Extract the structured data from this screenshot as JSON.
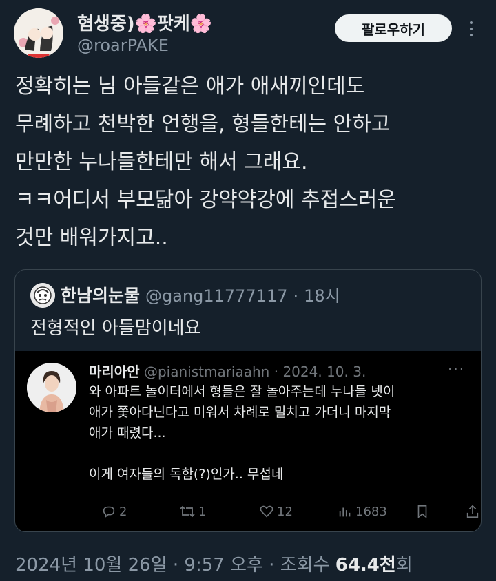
{
  "author": {
    "display_name": "혐생중)🌸팟케🌸",
    "handle": "@roarPAKE",
    "follow_label": "팔로우하기"
  },
  "tweet": {
    "text": "정확히는 님 아들같은 애가 애새끼인데도\n무례하고 천박한 언행을, 형들한테는 안하고\n만만한 누나들한테만 해서 그래요.\nㅋㅋ어디서 부모닮아 강약약강에 추접스러운\n것만 배워가지고.."
  },
  "quote": {
    "name": "한남의눈물",
    "handle": "@gang11777117",
    "time": "18시",
    "text": "전형적인 아들맘이네요",
    "embedded": {
      "name": "마리아안",
      "handle": "@pianistmariaahn",
      "date": "2024. 10. 3.",
      "more": "···",
      "text": "와 아파트 놀이터에서 형들은 잘 놀아주는데 누나들 넷이\n애가 쫓아다닌다고 미워서 차례로 밀치고 가더니 마지막\n애가 때렸다...\n\n이게 여자들의 독함(?)인가.. 무섭네",
      "stats": {
        "replies": "2",
        "retweets": "1",
        "likes": "12",
        "views": "1683"
      }
    }
  },
  "footer": {
    "date_time": "2024년 10월 26일 · 9:57 오후 · 조회수 ",
    "views_value": "64.4천",
    "views_suffix": "회"
  },
  "colors": {
    "background": "#15202b",
    "text": "#e7e9ea",
    "muted": "#8b98a5",
    "border": "#38444d",
    "button_bg": "#eff3f4"
  },
  "icons": [
    "more-vertical-icon",
    "reply-icon",
    "retweet-icon",
    "like-icon",
    "views-icon",
    "bookmark-icon",
    "share-icon"
  ]
}
